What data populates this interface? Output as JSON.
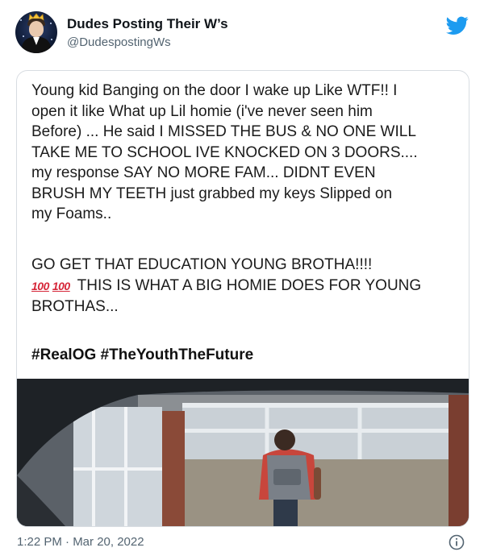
{
  "author": {
    "name": "Dudes Posting Their W’s",
    "handle": "@DudespostingWs"
  },
  "tweet": {
    "paragraph1": "Young kid Banging on the door I wake up Like WTF!! I\nopen it like What up Lil homie (i've never seen him\nBefore) ... He said I MISSED THE BUS & NO ONE WILL\nTAKE ME TO SCHOOL IVE KNOCKED ON 3 DOORS....\nmy response SAY NO MORE FAM...  DIDNT EVEN\nBRUSH MY TEETH just grabbed my keys Slipped on\nmy Foams..",
    "paragraph2_line1": "GO GET THAT EDUCATION YOUNG BROTHA!!!!",
    "emoji1": "100",
    "emoji2": "100",
    "paragraph2_rest": " THIS IS WHAT A BIG HOMIE DOES FOR YOUNG BROTHAS...",
    "hashtags": "#RealOG #TheYouthTheFuture"
  },
  "footer": {
    "timestamp": "1:22 PM · Mar 20, 2022"
  },
  "colors": {
    "twitter_blue": "#1d9bf0",
    "secondary_text": "#536471"
  },
  "icons": [
    "twitter-bird-icon",
    "info-icon",
    "hundred-points-emoji"
  ]
}
